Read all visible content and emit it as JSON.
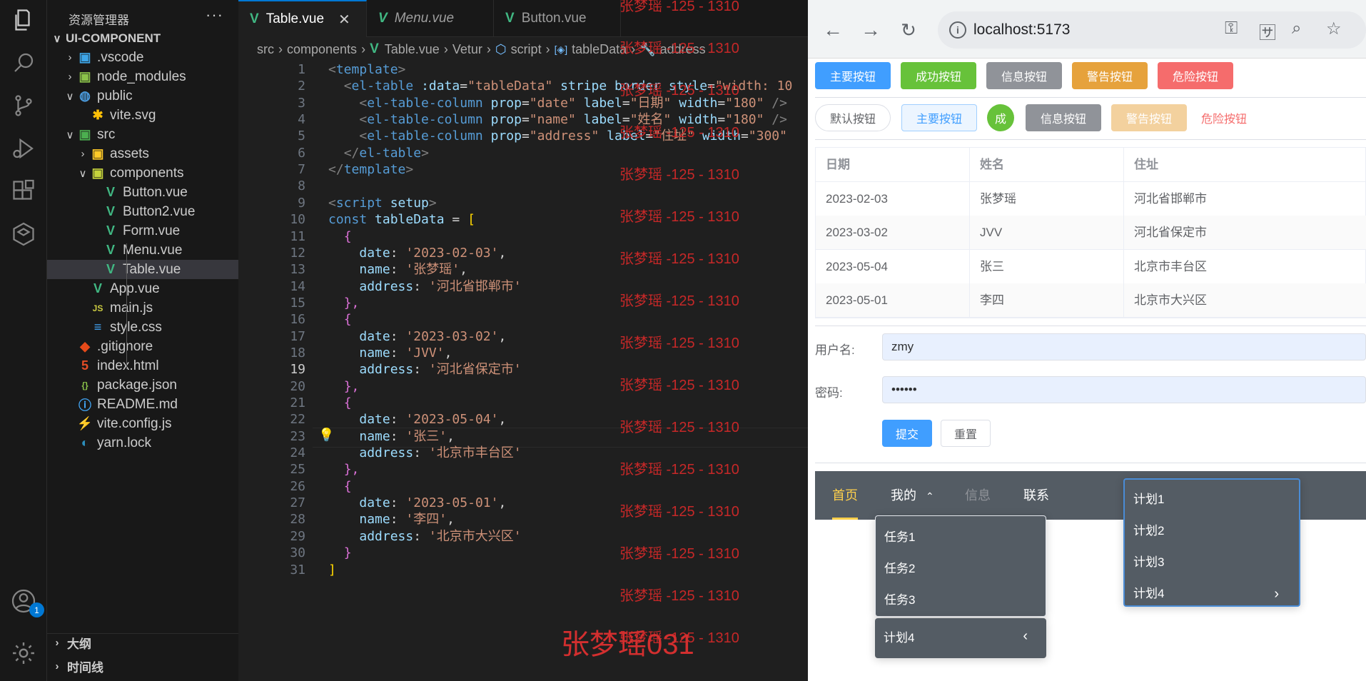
{
  "vscode": {
    "activity_badge": "1",
    "explorer_title": "资源管理器",
    "explorer_more": "···",
    "tree": [
      {
        "label": "UI-COMPONENT",
        "chev": "∨",
        "icon": "",
        "indent": 0,
        "bold": true
      },
      {
        "label": ".vscode",
        "chev": "›",
        "icon": "vscode-folder-icon",
        "indent": 1
      },
      {
        "label": "node_modules",
        "chev": "›",
        "icon": "node-folder-icon",
        "indent": 1
      },
      {
        "label": "public",
        "chev": "∨",
        "icon": "public-folder-icon",
        "indent": 1
      },
      {
        "label": "vite.svg",
        "chev": "",
        "icon": "vite-svg-icon",
        "indent": 2
      },
      {
        "label": "src",
        "chev": "∨",
        "icon": "src-folder-icon",
        "indent": 1
      },
      {
        "label": "assets",
        "chev": "›",
        "icon": "assets-folder-icon",
        "indent": 2
      },
      {
        "label": "components",
        "chev": "∨",
        "icon": "components-folder-icon",
        "indent": 2
      },
      {
        "label": "Button.vue",
        "chev": "",
        "icon": "vue-file-icon",
        "indent": 3
      },
      {
        "label": "Button2.vue",
        "chev": "",
        "icon": "vue-file-icon",
        "indent": 3
      },
      {
        "label": "Form.vue",
        "chev": "",
        "icon": "vue-file-icon",
        "indent": 3
      },
      {
        "label": "Menu.vue",
        "chev": "",
        "icon": "vue-file-icon",
        "indent": 3
      },
      {
        "label": "Table.vue",
        "chev": "",
        "icon": "vue-file-icon",
        "indent": 3,
        "selected": true
      },
      {
        "label": "App.vue",
        "chev": "",
        "icon": "vue-file-icon",
        "indent": 2
      },
      {
        "label": "main.js",
        "chev": "",
        "icon": "js-file-icon",
        "indent": 2
      },
      {
        "label": "style.css",
        "chev": "",
        "icon": "css-file-icon",
        "indent": 2
      },
      {
        "label": ".gitignore",
        "chev": "",
        "icon": "git-file-icon",
        "indent": 1
      },
      {
        "label": "index.html",
        "chev": "",
        "icon": "html-file-icon",
        "indent": 1
      },
      {
        "label": "package.json",
        "chev": "",
        "icon": "json-file-icon",
        "indent": 1
      },
      {
        "label": "README.md",
        "chev": "",
        "icon": "info-file-icon",
        "indent": 1
      },
      {
        "label": "vite.config.js",
        "chev": "",
        "icon": "vite-config-icon",
        "indent": 1
      },
      {
        "label": "yarn.lock",
        "chev": "",
        "icon": "yarn-file-icon",
        "indent": 1
      }
    ],
    "outline_label": "大纲",
    "timeline_label": "时间线",
    "tabs": [
      {
        "label": "Table.vue",
        "active": true,
        "close": "✕"
      },
      {
        "label": "Menu.vue"
      },
      {
        "label": "Button.vue"
      }
    ],
    "breadcrumb": [
      "src",
      "components",
      "Table.vue",
      "Vetur",
      "script",
      "tableData",
      "address"
    ],
    "current_line": 19,
    "code": [
      [
        [
          "<",
          "b"
        ],
        [
          "template",
          "t"
        ],
        [
          ">",
          "b"
        ]
      ],
      [
        [
          "  ",
          "w"
        ],
        [
          "<",
          "b"
        ],
        [
          "el-table",
          "t"
        ],
        [
          " :data",
          "a"
        ],
        [
          "=",
          "w"
        ],
        [
          "\"tableData\"",
          "s"
        ],
        [
          " stripe",
          "a"
        ],
        [
          " border",
          "a"
        ],
        [
          " style",
          "a"
        ],
        [
          "=",
          "w"
        ],
        [
          "\"width: 10",
          "s"
        ]
      ],
      [
        [
          "    ",
          "w"
        ],
        [
          "<",
          "b"
        ],
        [
          "el-table-column",
          "t"
        ],
        [
          " prop",
          "a"
        ],
        [
          "=",
          "w"
        ],
        [
          "\"date\"",
          "s"
        ],
        [
          " label",
          "a"
        ],
        [
          "=",
          "w"
        ],
        [
          "\"日期\"",
          "s"
        ],
        [
          " width",
          "a"
        ],
        [
          "=",
          "w"
        ],
        [
          "\"180\"",
          "s"
        ],
        [
          " />",
          "b"
        ]
      ],
      [
        [
          "    ",
          "w"
        ],
        [
          "<",
          "b"
        ],
        [
          "el-table-column",
          "t"
        ],
        [
          " prop",
          "a"
        ],
        [
          "=",
          "w"
        ],
        [
          "\"name\"",
          "s"
        ],
        [
          " label",
          "a"
        ],
        [
          "=",
          "w"
        ],
        [
          "\"姓名\"",
          "s"
        ],
        [
          " width",
          "a"
        ],
        [
          "=",
          "w"
        ],
        [
          "\"180\"",
          "s"
        ],
        [
          " />",
          "b"
        ]
      ],
      [
        [
          "    ",
          "w"
        ],
        [
          "<",
          "b"
        ],
        [
          "el-table-column",
          "t"
        ],
        [
          " prop",
          "a"
        ],
        [
          "=",
          "w"
        ],
        [
          "\"address\"",
          "s"
        ],
        [
          " label",
          "a"
        ],
        [
          "=",
          "w"
        ],
        [
          "\"住址\"",
          "s"
        ],
        [
          " width",
          "a"
        ],
        [
          "=",
          "w"
        ],
        [
          "\"300\"",
          "s"
        ]
      ],
      [
        [
          "  ",
          "w"
        ],
        [
          "</",
          "b"
        ],
        [
          "el-table",
          "t"
        ],
        [
          ">",
          "b"
        ]
      ],
      [
        [
          "</",
          "b"
        ],
        [
          "template",
          "t"
        ],
        [
          ">",
          "b"
        ]
      ],
      [
        [
          "",
          "w"
        ]
      ],
      [
        [
          "<",
          "b"
        ],
        [
          "script",
          "t"
        ],
        [
          " setup",
          "a"
        ],
        [
          ">",
          "b"
        ]
      ],
      [
        [
          "const",
          "k"
        ],
        [
          " tableData",
          "v"
        ],
        [
          " = ",
          "w"
        ],
        [
          "[",
          "y"
        ]
      ],
      [
        [
          "  ",
          "w"
        ],
        [
          "{",
          "br"
        ]
      ],
      [
        [
          "    ",
          "w"
        ],
        [
          "date",
          "v"
        ],
        [
          ": ",
          "w"
        ],
        [
          "'2023-02-03'",
          "s"
        ],
        [
          ",",
          "w"
        ]
      ],
      [
        [
          "    ",
          "w"
        ],
        [
          "name",
          "v"
        ],
        [
          ": ",
          "w"
        ],
        [
          "'张梦瑶'",
          "s"
        ],
        [
          ",",
          "w"
        ]
      ],
      [
        [
          "    ",
          "w"
        ],
        [
          "address",
          "v"
        ],
        [
          ": ",
          "w"
        ],
        [
          "'河北省邯郸市'",
          "s"
        ]
      ],
      [
        [
          "  ",
          "w"
        ],
        [
          "},",
          "br"
        ]
      ],
      [
        [
          "  ",
          "w"
        ],
        [
          "{",
          "br"
        ]
      ],
      [
        [
          "    ",
          "w"
        ],
        [
          "date",
          "v"
        ],
        [
          ": ",
          "w"
        ],
        [
          "'2023-03-02'",
          "s"
        ],
        [
          ",",
          "w"
        ]
      ],
      [
        [
          "    ",
          "w"
        ],
        [
          "name",
          "v"
        ],
        [
          ": ",
          "w"
        ],
        [
          "'JVV'",
          "s"
        ],
        [
          ",",
          "w"
        ]
      ],
      [
        [
          "    ",
          "w"
        ],
        [
          "address",
          "v"
        ],
        [
          ": ",
          "w"
        ],
        [
          "'河北省保定市'",
          "s"
        ]
      ],
      [
        [
          "  ",
          "w"
        ],
        [
          "},",
          "br"
        ]
      ],
      [
        [
          "  ",
          "w"
        ],
        [
          "{",
          "br"
        ]
      ],
      [
        [
          "    ",
          "w"
        ],
        [
          "date",
          "v"
        ],
        [
          ": ",
          "w"
        ],
        [
          "'2023-05-04'",
          "s"
        ],
        [
          ",",
          "w"
        ]
      ],
      [
        [
          "    ",
          "w"
        ],
        [
          "name",
          "v"
        ],
        [
          ": ",
          "w"
        ],
        [
          "'张三'",
          "s"
        ],
        [
          ",",
          "w"
        ]
      ],
      [
        [
          "    ",
          "w"
        ],
        [
          "address",
          "v"
        ],
        [
          ": ",
          "w"
        ],
        [
          "'北京市丰台区'",
          "s"
        ]
      ],
      [
        [
          "  ",
          "w"
        ],
        [
          "},",
          "br"
        ]
      ],
      [
        [
          "  ",
          "w"
        ],
        [
          "{",
          "br"
        ]
      ],
      [
        [
          "    ",
          "w"
        ],
        [
          "date",
          "v"
        ],
        [
          ": ",
          "w"
        ],
        [
          "'2023-05-01'",
          "s"
        ],
        [
          ",",
          "w"
        ]
      ],
      [
        [
          "    ",
          "w"
        ],
        [
          "name",
          "v"
        ],
        [
          ": ",
          "w"
        ],
        [
          "'李四'",
          "s"
        ],
        [
          ",",
          "w"
        ]
      ],
      [
        [
          "    ",
          "w"
        ],
        [
          "address",
          "v"
        ],
        [
          ": ",
          "w"
        ],
        [
          "'北京市大兴区'",
          "s"
        ]
      ],
      [
        [
          "  ",
          "w"
        ],
        [
          "}",
          "br"
        ]
      ],
      [
        [
          "]",
          "y"
        ]
      ]
    ],
    "watermark": "张梦瑶 -125 - 1310",
    "big_watermark": "张梦瑶031"
  },
  "browser": {
    "url": "localhost:5173",
    "buttons_row1": [
      {
        "label": "主要按钮",
        "color": "#409eff"
      },
      {
        "label": "成功按钮",
        "color": "#67c23a"
      },
      {
        "label": "信息按钮",
        "color": "#909399"
      },
      {
        "label": "警告按钮",
        "color": "#e6a23c"
      },
      {
        "label": "危险按钮",
        "color": "#f56c6c"
      }
    ],
    "buttons_row2": [
      {
        "label": "默认按钮",
        "style": "round"
      },
      {
        "label": "主要按钮",
        "style": "plain"
      },
      {
        "label": "成",
        "style": "circle"
      },
      {
        "label": "信息按钮",
        "style": "info"
      },
      {
        "label": "警告按钮",
        "style": "disabled"
      },
      {
        "label": "危险按钮",
        "style": "text"
      }
    ],
    "table": {
      "headers": [
        "日期",
        "姓名",
        "住址"
      ],
      "rows": [
        [
          "2023-02-03",
          "张梦瑶",
          "河北省邯郸市"
        ],
        [
          "2023-03-02",
          "JVV",
          "河北省保定市"
        ],
        [
          "2023-05-04",
          "张三",
          "北京市丰台区"
        ],
        [
          "2023-05-01",
          "李四",
          "北京市大兴区"
        ]
      ]
    },
    "form": {
      "username_label": "用户名:",
      "username_value": "zmy",
      "password_label": "密码:",
      "password_value": "••••••",
      "submit_label": "提交",
      "reset_label": "重置"
    },
    "menu": {
      "items": [
        "首页",
        "我的",
        "信息",
        "联系"
      ],
      "chevron_up": "⌃",
      "submenu1": [
        "任务1",
        "任务2",
        "任务3"
      ],
      "submenu1_footer": "计划4",
      "submenu1_footer_arrow": "‹",
      "submenu2": [
        "计划1",
        "计划2",
        "计划3",
        "计划4"
      ],
      "submenu2_arrow": "›"
    }
  }
}
